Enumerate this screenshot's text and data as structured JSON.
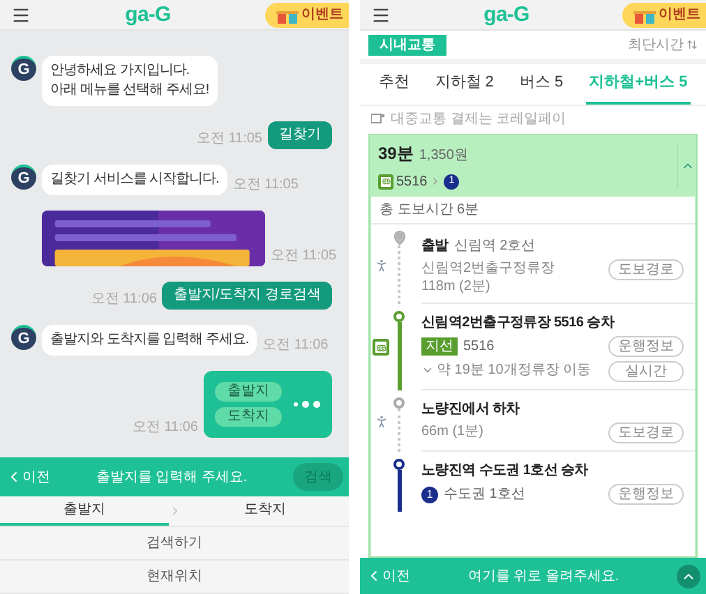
{
  "chat_screen": {
    "header": {
      "logo": "ga-G",
      "event_badge": "이벤트"
    },
    "messages": [
      {
        "kind": "bot",
        "avatar": "G",
        "text": "안녕하세요 가지입니다.\n아래 메뉴를 선택해 주세요!"
      },
      {
        "kind": "user",
        "text": "길찾기",
        "time": "오전 11:05"
      },
      {
        "kind": "bot",
        "avatar": "G",
        "text": "길찾기 서비스를 시작합니다.",
        "time": "오전 11:05"
      },
      {
        "kind": "banner",
        "time": "오전 11:05"
      },
      {
        "kind": "user",
        "text": "출발지/도착지 경로검색",
        "time": "오전 11:06"
      },
      {
        "kind": "bot",
        "avatar": "G",
        "text": "출발지와 도착지를 입력해 주세요.",
        "time": "오전 11:06"
      },
      {
        "kind": "choices",
        "options": [
          "출발지",
          "도착지"
        ],
        "time": "오전 11:06"
      }
    ],
    "bottom_bar": {
      "back": "이전",
      "title": "출발지를 입력해 주세요.",
      "search_button": {
        "label": "검색",
        "disabled": true
      }
    },
    "tabs": [
      {
        "label": "출발지",
        "selected": true
      },
      {
        "label": "도착지",
        "selected": false
      }
    ],
    "options": [
      "검색하기",
      "현재위치"
    ]
  },
  "route_screen": {
    "header": {
      "logo": "ga-G",
      "event_badge": "이벤트"
    },
    "category": "시내교통",
    "sort": "최단시간",
    "tabs": [
      {
        "label": "추천",
        "selected": false
      },
      {
        "label": "지하철 2",
        "selected": false
      },
      {
        "label": "버스 5",
        "selected": false
      },
      {
        "label": "지하철+버스 5",
        "selected": true
      }
    ],
    "notice": "대중교통 결제는 코레일페이",
    "route": {
      "duration": "39분",
      "fare": "1,350원",
      "bus_number": "5516",
      "subway_line": "1",
      "expanded": true,
      "walk_total": "총 도보시간 6분",
      "steps": [
        {
          "kind": "start",
          "title": "출발",
          "subtitle": "신림역 2호선",
          "details": [
            "신림역2번출구정류장",
            "118m (2분)"
          ],
          "buttons": [
            "도보경로"
          ]
        },
        {
          "kind": "bus",
          "title": "신림역2번출구정류장 5516 승차",
          "tag": "지선",
          "line": "5516",
          "buttons": [
            "운행정보",
            "실시간"
          ],
          "stops": "약 19분 10개정류장 이동"
        },
        {
          "kind": "alight",
          "title": "노량진에서 하차",
          "details": [
            "66m (1분)"
          ],
          "buttons": [
            "도보경로"
          ]
        },
        {
          "kind": "subway",
          "title": "노량진역 수도권 1호선 승차",
          "badge": "1",
          "line": "수도권 1호선",
          "buttons": [
            "운행정보"
          ]
        }
      ]
    },
    "bottom_bar": {
      "back": "이전",
      "title": "여기를 위로 올려주세요."
    }
  }
}
